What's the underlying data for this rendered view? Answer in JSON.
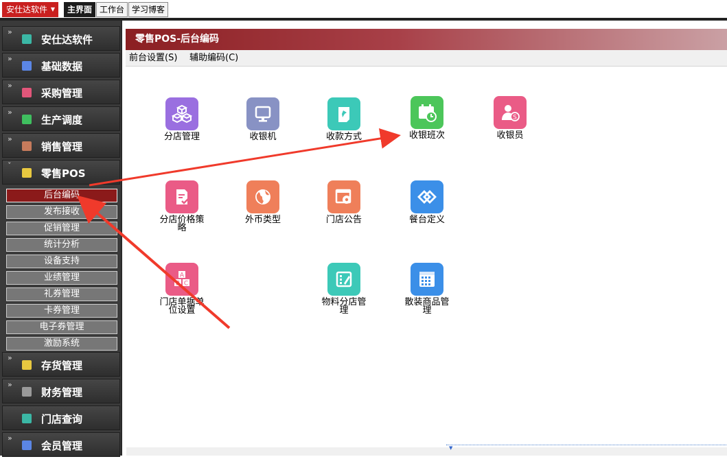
{
  "top": {
    "app_menu": "安仕达软件",
    "tabs": [
      {
        "label": "主界面",
        "active": true
      },
      {
        "label": "工作台",
        "active": false
      },
      {
        "label": "学习博客",
        "active": false
      }
    ]
  },
  "sidebar": {
    "modules": [
      {
        "label": "安仕达软件",
        "icon": "teal-cube-icon",
        "color": "#3bb7a5"
      },
      {
        "label": "基础数据",
        "icon": "blue-box-icon",
        "color": "#5b86e5"
      },
      {
        "label": "采购管理",
        "icon": "pink-box-icon",
        "color": "#e2567a"
      },
      {
        "label": "生产调度",
        "icon": "green-box-icon",
        "color": "#3fbf5f"
      },
      {
        "label": "销售管理",
        "icon": "brown-box-icon",
        "color": "#c67b5c"
      },
      {
        "label": "零售POS",
        "icon": "yellow-box-icon",
        "color": "#e8c840"
      },
      {
        "label": "存货管理",
        "icon": "yellow-box-icon",
        "color": "#e8c840"
      },
      {
        "label": "财务管理",
        "icon": "gray-box-icon",
        "color": "#9a9a9a"
      },
      {
        "label": "门店查询",
        "icon": "teal-cube-icon",
        "color": "#3bb7a5"
      },
      {
        "label": "会员管理",
        "icon": "blue-box-icon",
        "color": "#5b86e5"
      }
    ],
    "submenu": [
      {
        "label": "后台编码",
        "active": true
      },
      {
        "label": "发布接收",
        "active": false
      },
      {
        "label": "促销管理",
        "active": false
      },
      {
        "label": "统计分析",
        "active": false
      },
      {
        "label": "设备支持",
        "active": false
      },
      {
        "label": "业绩管理",
        "active": false
      },
      {
        "label": "礼券管理",
        "active": false
      },
      {
        "label": "卡券管理",
        "active": false
      },
      {
        "label": "电子券管理",
        "active": false
      },
      {
        "label": "激励系统",
        "active": false
      }
    ]
  },
  "main": {
    "title": "零售POS-后台编码",
    "menus": [
      "前台设置(S)",
      "辅助编码(C)"
    ],
    "tiles": [
      {
        "label": "分店管理",
        "icon": "cubes-icon",
        "color": "#9a6fe0"
      },
      {
        "label": "收银机",
        "icon": "monitor-icon",
        "color": "#8892c4"
      },
      {
        "label": "收款方式",
        "icon": "pin-note-icon",
        "color": "#3cc9b8"
      },
      {
        "label": "收银班次",
        "icon": "calendar-clock-icon",
        "color": "#4cc65a"
      },
      {
        "label": "收银员",
        "icon": "cashier-icon",
        "color": "#ea5b86"
      },
      {
        "label": "分店价格策略",
        "icon": "price-doc-icon",
        "color": "#ea5b86"
      },
      {
        "label": "外币类型",
        "icon": "globe-icon",
        "color": "#ef7f5a"
      },
      {
        "label": "门店公告",
        "icon": "notice-gear-icon",
        "color": "#ef7f5a"
      },
      {
        "label": "餐台定义",
        "icon": "diamond-link-icon",
        "color": "#3b8fe8"
      },
      {
        "label": "门店单据单位设置",
        "icon": "abc-icon",
        "color": "#ea5b86"
      },
      {
        "label": "物料分店管理",
        "icon": "edit-grid-icon",
        "color": "#3cc9b8"
      },
      {
        "label": "散装商品管理",
        "icon": "calendar-grid-icon",
        "color": "#3b8fe8"
      }
    ]
  }
}
